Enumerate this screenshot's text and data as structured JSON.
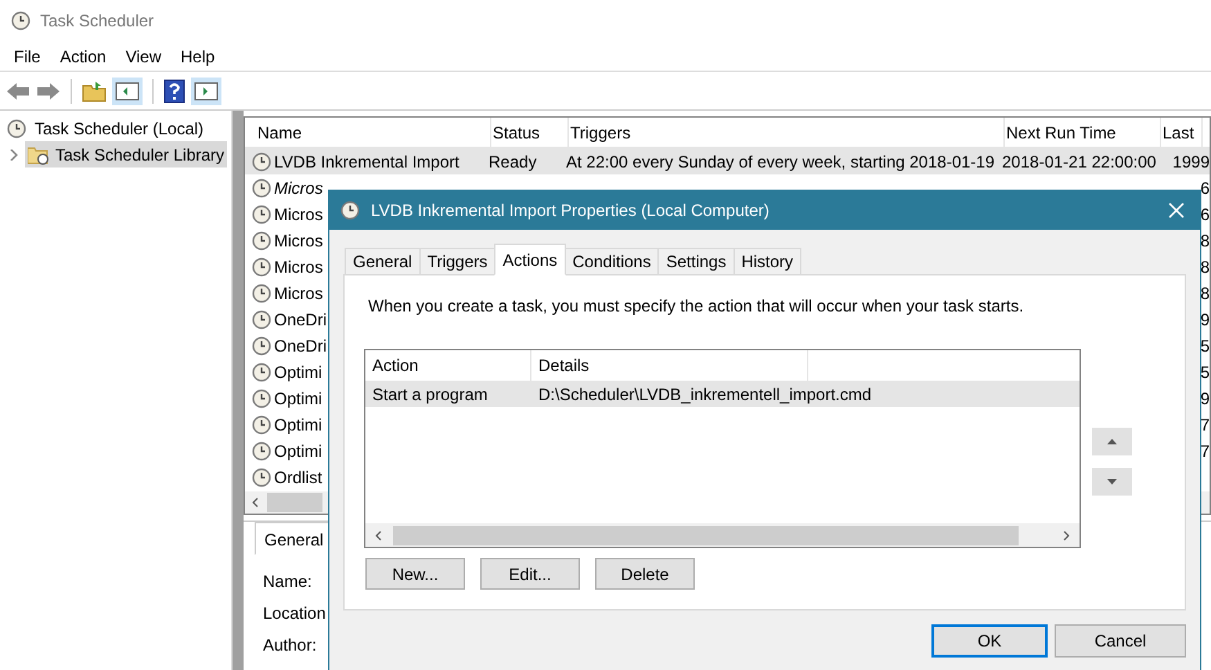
{
  "window": {
    "title": "Task Scheduler"
  },
  "menu": [
    "File",
    "Action",
    "View",
    "Help"
  ],
  "tree": [
    {
      "label": "Task Scheduler (Local)",
      "selected": false,
      "children": [
        {
          "label": "Task Scheduler Library",
          "selected": true,
          "expanded": false
        }
      ]
    }
  ],
  "task_list": {
    "columns": [
      "Name",
      "Status",
      "Triggers",
      "Next Run Time",
      "Last"
    ],
    "rows": [
      {
        "name": "LVDB Inkremental Import",
        "status": "Ready",
        "triggers": "At 22:00 every Sunday of every week, starting 2018-01-19",
        "next_run": "2018-01-21 22:00:00",
        "last": "1999",
        "selected": true,
        "italic": false
      },
      {
        "name": "Micros",
        "last": "6",
        "selected": false,
        "italic": true
      },
      {
        "name": "Micros",
        "last": "6",
        "selected": false,
        "italic": false
      },
      {
        "name": "Micros",
        "last": "8",
        "selected": false,
        "italic": false
      },
      {
        "name": "Micros",
        "last": "8",
        "selected": false,
        "italic": false
      },
      {
        "name": "Micros",
        "last": "8",
        "selected": false,
        "italic": false
      },
      {
        "name": "OneDri",
        "last": "9",
        "selected": false,
        "italic": false
      },
      {
        "name": "OneDri",
        "last": "5",
        "selected": false,
        "italic": false
      },
      {
        "name": "Optimi",
        "last": "5",
        "selected": false,
        "italic": false
      },
      {
        "name": "Optimi",
        "last": "9",
        "selected": false,
        "italic": false
      },
      {
        "name": "Optimi",
        "last": "7",
        "selected": false,
        "italic": false
      },
      {
        "name": "Optimi",
        "last": "7",
        "selected": false,
        "italic": false
      },
      {
        "name": "Ordlist",
        "selected": false,
        "italic": false
      }
    ]
  },
  "detail_pane": {
    "tabs": [
      {
        "label": "General",
        "selected": true
      }
    ],
    "fields": [
      "Name:",
      "Location",
      "Author:"
    ]
  },
  "dialog": {
    "title": "LVDB Inkremental Import Properties (Local Computer)",
    "tabs": [
      {
        "label": "General",
        "selected": false
      },
      {
        "label": "Triggers",
        "selected": false
      },
      {
        "label": "Actions",
        "selected": true
      },
      {
        "label": "Conditions",
        "selected": false
      },
      {
        "label": "Settings",
        "selected": false
      },
      {
        "label": "History",
        "selected": false
      }
    ],
    "description": "When you create a task, you must specify the action that will occur when your task starts.",
    "actions_table": {
      "columns": [
        "Action",
        "Details"
      ],
      "rows": [
        {
          "action": "Start a program",
          "details": "D:\\Scheduler\\LVDB_inkrementell_import.cmd",
          "selected": true
        }
      ]
    },
    "buttons": [
      "New...",
      "Edit...",
      "Delete"
    ],
    "footer_buttons": [
      {
        "label": "OK",
        "default": true
      },
      {
        "label": "Cancel",
        "default": false
      }
    ]
  }
}
